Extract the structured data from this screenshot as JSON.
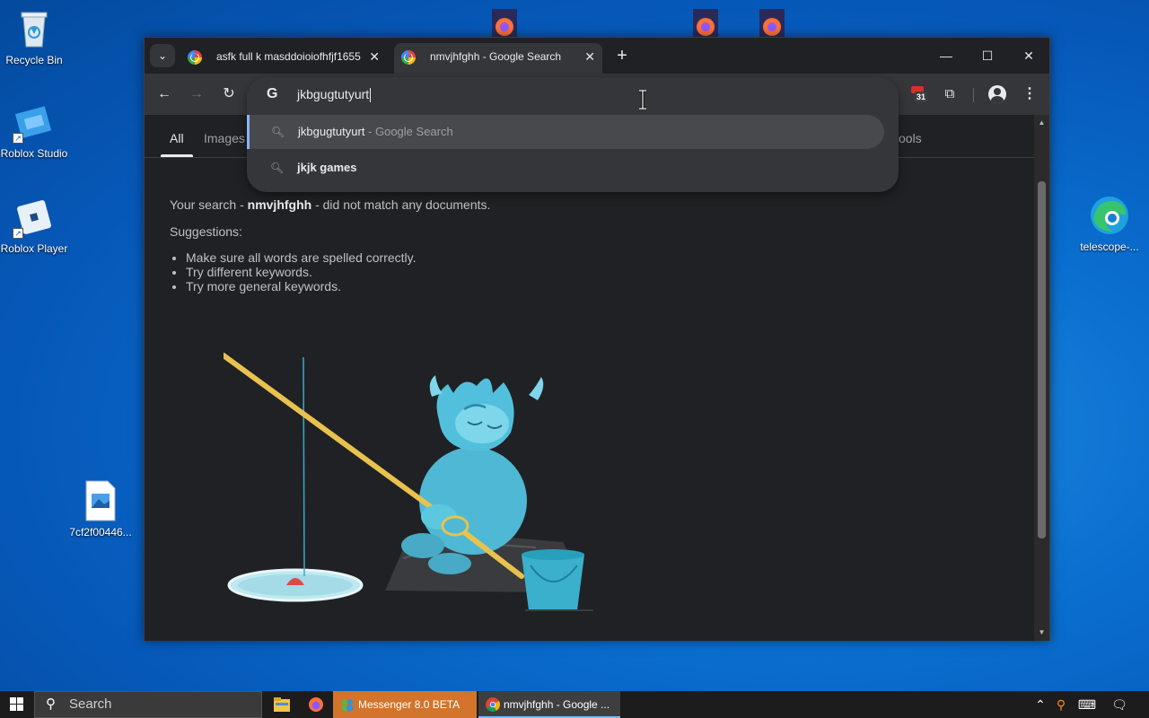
{
  "desktop": {
    "icons": [
      {
        "label": "Recycle Bin"
      },
      {
        "label": "Roblox Studio"
      },
      {
        "label": "Roblox Player"
      },
      {
        "label": "7cf2f00446..."
      },
      {
        "label": "telescope-..."
      }
    ]
  },
  "browser": {
    "tabs": [
      {
        "title": "asfk full k masddoioiofhfjf1655",
        "active": false
      },
      {
        "title": "nmvjhfghh - Google Search",
        "active": true
      }
    ],
    "new_tab_symbol": "+",
    "controls": {
      "minimize": "—",
      "maximize": "☐",
      "close": "✕"
    },
    "omnibox": {
      "value": "jkbgugtutyurt",
      "g_letter": "G",
      "suggestions": [
        {
          "main": "jkbgugtutyurt",
          "sub": " - Google Search",
          "selected": true
        },
        {
          "main": "jkjk games",
          "sub": "",
          "selected": false
        }
      ]
    },
    "calendar_badge": "31"
  },
  "page": {
    "tabs": [
      "All",
      "Images"
    ],
    "tools_partial": "ools",
    "no_match": {
      "prefix": "Your search - ",
      "query": "nmvjhfghh",
      "suffix": " - did not match any documents."
    },
    "suggestions_title": "Suggestions:",
    "suggestions": [
      "Make sure all words are spelled correctly.",
      "Try different keywords.",
      "Try more general keywords."
    ]
  },
  "taskbar": {
    "search_label": "Search",
    "apps": [
      {
        "label": "Messenger 8.0 BETA"
      },
      {
        "label": "nmvjhfghh - Google ..."
      }
    ]
  },
  "colors": {
    "window_bg": "#202124",
    "toolbar_bg": "#35363a",
    "accent_blue": "#8ab4f8",
    "messenger_orange": "#d2742b",
    "yeti_teal": "#4fb8d4"
  }
}
